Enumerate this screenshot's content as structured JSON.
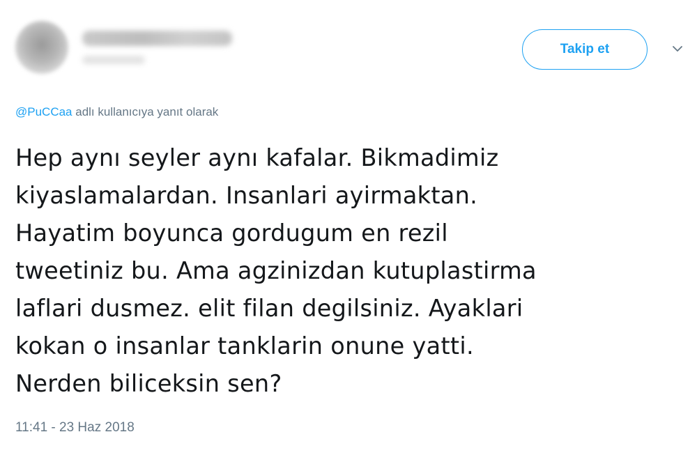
{
  "header": {
    "follow_label": "Takip et",
    "menu_icon": "chevron-down-icon"
  },
  "reply": {
    "mention": "@PuCCaa",
    "text": "adlı kullanıcıya yanıt olarak"
  },
  "tweet": {
    "lines": [
      "Hep aynı seyler aynı kafalar. Bikmadimiz",
      "kiyaslamalardan. Insanlari ayirmaktan.",
      "Hayatim boyunca gordugum en rezil",
      "tweetiniz bu. Ama agzinizdan kutuplastirma",
      "laflari dusmez. elit filan degilsiniz. Ayaklari",
      "kokan o insanlar tanklarin onune yatti.",
      "Nerden biliceksin sen?"
    ],
    "timestamp": "11:41 - 23 Haz 2018"
  },
  "colors": {
    "accent": "#1da1f2",
    "secondary_text": "#657786",
    "primary_text": "#14171a"
  }
}
